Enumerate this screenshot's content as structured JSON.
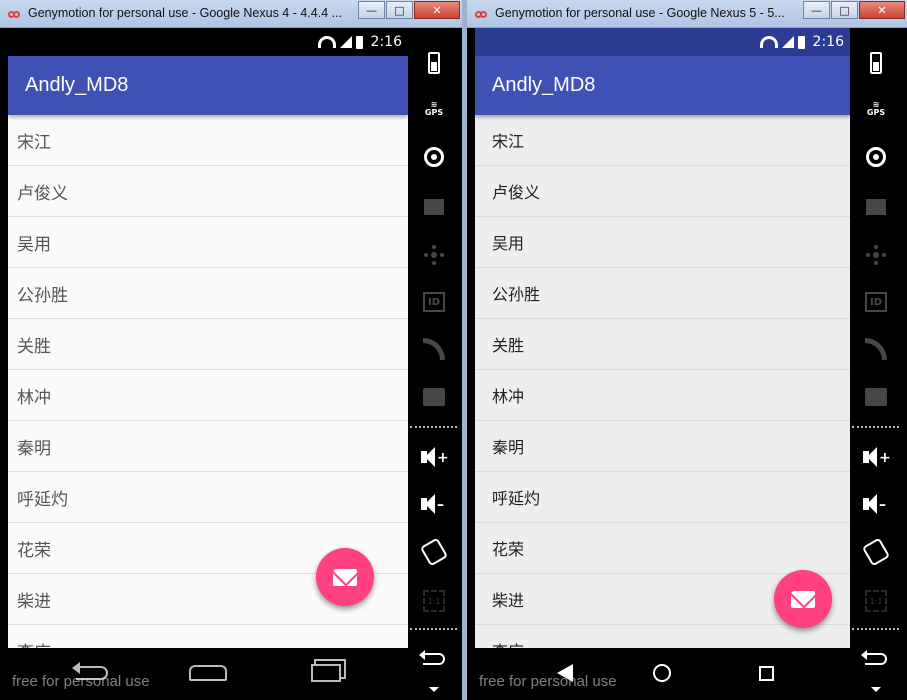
{
  "windows": [
    {
      "title": "Genymotion for personal use - Google Nexus 4 - 4.4.4 ...",
      "status_time": "2:16",
      "app_title": "Andly_MD8",
      "items": [
        "宋江",
        "卢俊义",
        "吴用",
        "公孙胜",
        "关胜",
        "林冲",
        "秦明",
        "呼延灼",
        "花荣",
        "柴进",
        "李应"
      ],
      "watermark": "free for personal use"
    },
    {
      "title": "Genymotion for personal use - Google Nexus 5 - 5...",
      "status_time": "2:16",
      "app_title": "Andly_MD8",
      "items": [
        "宋江",
        "卢俊义",
        "吴用",
        "公孙胜",
        "关胜",
        "林冲",
        "秦明",
        "呼延灼",
        "花荣",
        "柴进",
        "李应"
      ],
      "watermark": "free for personal use"
    }
  ],
  "window_buttons": {
    "minimize": "—",
    "maximize": "□",
    "close": "✕"
  },
  "side_panel": {
    "gps_label": "GPS",
    "id_label": "ID",
    "scale_label": "1:1"
  },
  "colors": {
    "primary": "#3f51b5",
    "primary_dark": "#2c3c92",
    "accent": "#ff4081"
  },
  "icons": [
    "genymotion-logo-icon",
    "wifi-icon",
    "signal-icon",
    "battery-icon",
    "mail-icon",
    "back-icon",
    "home-icon",
    "recent-apps-icon",
    "gps-icon",
    "camera-icon",
    "clapper-icon",
    "dpad-icon",
    "id-icon",
    "rss-icon",
    "sms-icon",
    "volume-up-icon",
    "volume-down-icon",
    "rotate-icon",
    "scale-icon",
    "more-icon"
  ]
}
